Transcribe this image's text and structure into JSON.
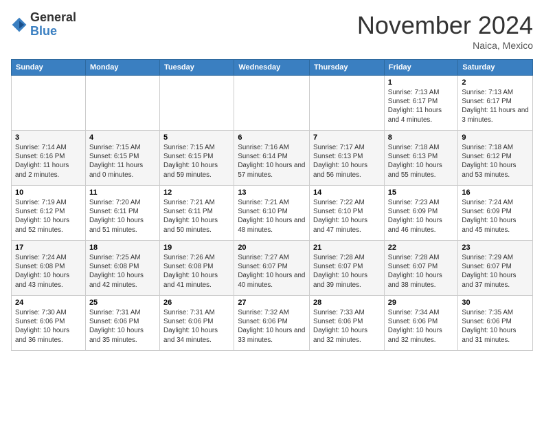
{
  "header": {
    "logo_general": "General",
    "logo_blue": "Blue",
    "month_title": "November 2024",
    "location": "Naica, Mexico"
  },
  "weekdays": [
    "Sunday",
    "Monday",
    "Tuesday",
    "Wednesday",
    "Thursday",
    "Friday",
    "Saturday"
  ],
  "weeks": [
    [
      {
        "day": "",
        "info": ""
      },
      {
        "day": "",
        "info": ""
      },
      {
        "day": "",
        "info": ""
      },
      {
        "day": "",
        "info": ""
      },
      {
        "day": "",
        "info": ""
      },
      {
        "day": "1",
        "info": "Sunrise: 7:13 AM\nSunset: 6:17 PM\nDaylight: 11 hours and 4 minutes."
      },
      {
        "day": "2",
        "info": "Sunrise: 7:13 AM\nSunset: 6:17 PM\nDaylight: 11 hours and 3 minutes."
      }
    ],
    [
      {
        "day": "3",
        "info": "Sunrise: 7:14 AM\nSunset: 6:16 PM\nDaylight: 11 hours and 2 minutes."
      },
      {
        "day": "4",
        "info": "Sunrise: 7:15 AM\nSunset: 6:15 PM\nDaylight: 11 hours and 0 minutes."
      },
      {
        "day": "5",
        "info": "Sunrise: 7:15 AM\nSunset: 6:15 PM\nDaylight: 10 hours and 59 minutes."
      },
      {
        "day": "6",
        "info": "Sunrise: 7:16 AM\nSunset: 6:14 PM\nDaylight: 10 hours and 57 minutes."
      },
      {
        "day": "7",
        "info": "Sunrise: 7:17 AM\nSunset: 6:13 PM\nDaylight: 10 hours and 56 minutes."
      },
      {
        "day": "8",
        "info": "Sunrise: 7:18 AM\nSunset: 6:13 PM\nDaylight: 10 hours and 55 minutes."
      },
      {
        "day": "9",
        "info": "Sunrise: 7:18 AM\nSunset: 6:12 PM\nDaylight: 10 hours and 53 minutes."
      }
    ],
    [
      {
        "day": "10",
        "info": "Sunrise: 7:19 AM\nSunset: 6:12 PM\nDaylight: 10 hours and 52 minutes."
      },
      {
        "day": "11",
        "info": "Sunrise: 7:20 AM\nSunset: 6:11 PM\nDaylight: 10 hours and 51 minutes."
      },
      {
        "day": "12",
        "info": "Sunrise: 7:21 AM\nSunset: 6:11 PM\nDaylight: 10 hours and 50 minutes."
      },
      {
        "day": "13",
        "info": "Sunrise: 7:21 AM\nSunset: 6:10 PM\nDaylight: 10 hours and 48 minutes."
      },
      {
        "day": "14",
        "info": "Sunrise: 7:22 AM\nSunset: 6:10 PM\nDaylight: 10 hours and 47 minutes."
      },
      {
        "day": "15",
        "info": "Sunrise: 7:23 AM\nSunset: 6:09 PM\nDaylight: 10 hours and 46 minutes."
      },
      {
        "day": "16",
        "info": "Sunrise: 7:24 AM\nSunset: 6:09 PM\nDaylight: 10 hours and 45 minutes."
      }
    ],
    [
      {
        "day": "17",
        "info": "Sunrise: 7:24 AM\nSunset: 6:08 PM\nDaylight: 10 hours and 43 minutes."
      },
      {
        "day": "18",
        "info": "Sunrise: 7:25 AM\nSunset: 6:08 PM\nDaylight: 10 hours and 42 minutes."
      },
      {
        "day": "19",
        "info": "Sunrise: 7:26 AM\nSunset: 6:08 PM\nDaylight: 10 hours and 41 minutes."
      },
      {
        "day": "20",
        "info": "Sunrise: 7:27 AM\nSunset: 6:07 PM\nDaylight: 10 hours and 40 minutes."
      },
      {
        "day": "21",
        "info": "Sunrise: 7:28 AM\nSunset: 6:07 PM\nDaylight: 10 hours and 39 minutes."
      },
      {
        "day": "22",
        "info": "Sunrise: 7:28 AM\nSunset: 6:07 PM\nDaylight: 10 hours and 38 minutes."
      },
      {
        "day": "23",
        "info": "Sunrise: 7:29 AM\nSunset: 6:07 PM\nDaylight: 10 hours and 37 minutes."
      }
    ],
    [
      {
        "day": "24",
        "info": "Sunrise: 7:30 AM\nSunset: 6:06 PM\nDaylight: 10 hours and 36 minutes."
      },
      {
        "day": "25",
        "info": "Sunrise: 7:31 AM\nSunset: 6:06 PM\nDaylight: 10 hours and 35 minutes."
      },
      {
        "day": "26",
        "info": "Sunrise: 7:31 AM\nSunset: 6:06 PM\nDaylight: 10 hours and 34 minutes."
      },
      {
        "day": "27",
        "info": "Sunrise: 7:32 AM\nSunset: 6:06 PM\nDaylight: 10 hours and 33 minutes."
      },
      {
        "day": "28",
        "info": "Sunrise: 7:33 AM\nSunset: 6:06 PM\nDaylight: 10 hours and 32 minutes."
      },
      {
        "day": "29",
        "info": "Sunrise: 7:34 AM\nSunset: 6:06 PM\nDaylight: 10 hours and 32 minutes."
      },
      {
        "day": "30",
        "info": "Sunrise: 7:35 AM\nSunset: 6:06 PM\nDaylight: 10 hours and 31 minutes."
      }
    ]
  ]
}
